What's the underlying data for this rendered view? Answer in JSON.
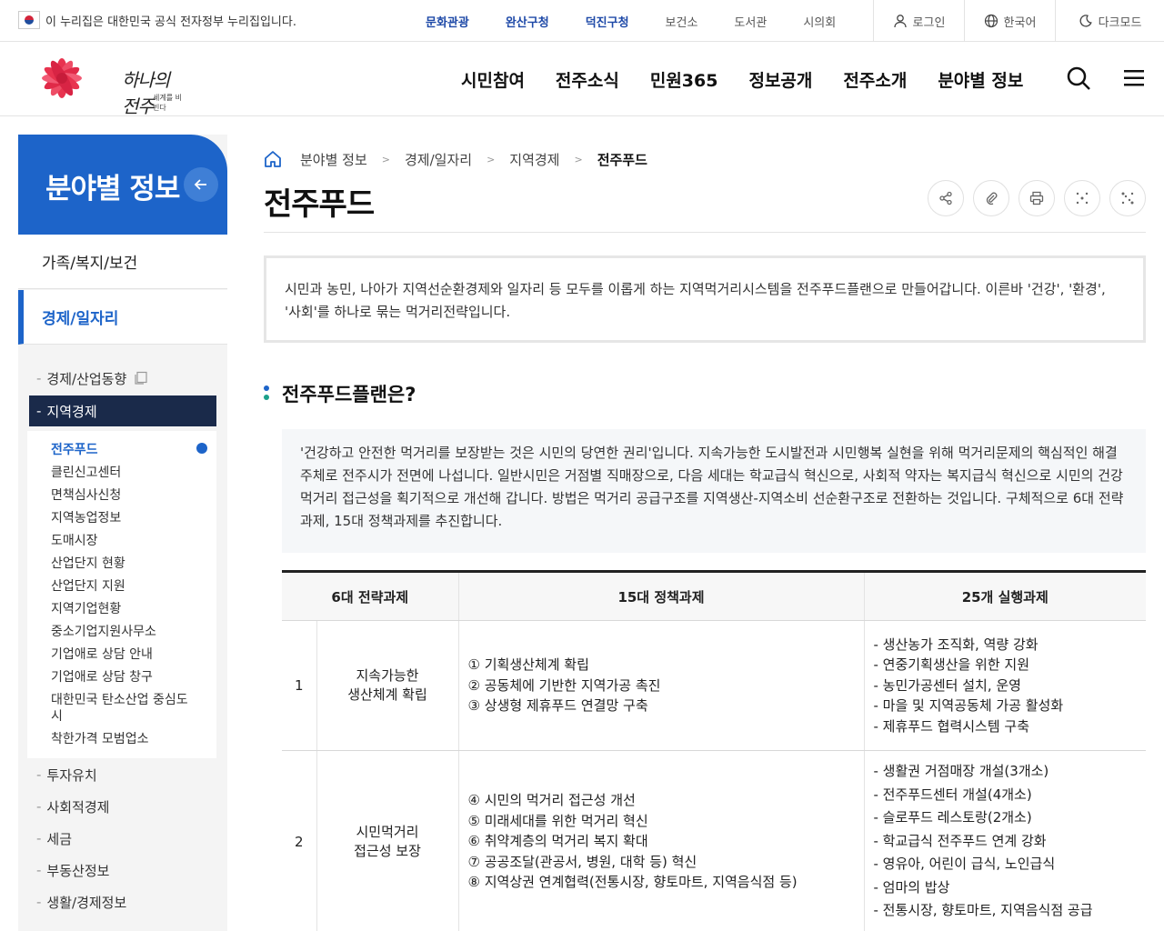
{
  "topbar": {
    "gov_notice": "이 누리집은 대한민국 공식 전자정부 누리집입니다.",
    "sites": [
      {
        "label": "문화관광",
        "highlight": true
      },
      {
        "label": "완산구청",
        "highlight": true
      },
      {
        "label": "덕진구청",
        "highlight": true
      },
      {
        "label": "보건소",
        "highlight": false
      },
      {
        "label": "도서관",
        "highlight": false
      },
      {
        "label": "시의회",
        "highlight": false
      }
    ],
    "login": "로그인",
    "language": "한국어",
    "dark_mode": "다크모드"
  },
  "header": {
    "logo_script": "하나의 전주",
    "logo_sub": "세계를 비빈다",
    "nav": [
      "시민참여",
      "전주소식",
      "민원365",
      "정보공개",
      "전주소개",
      "분야별 정보"
    ]
  },
  "sidebar": {
    "title": "분야별 정보",
    "categories": [
      "가족/복지/보건",
      "경제/일자리"
    ],
    "subs_top": [
      "경제/산업동향",
      "지역경제"
    ],
    "leaves": [
      "전주푸드",
      "클린신고센터",
      "면책심사신청",
      "지역농업정보",
      "도매시장",
      "산업단지 현황",
      "산업단지 지원",
      "지역기업현황",
      "중소기업지원사무소",
      "기업애로 상담 안내",
      "기업애로 상담 창구",
      "대한민국 탄소산업 중심도시",
      "착한가격 모범업소"
    ],
    "subs_bottom": [
      "투자유치",
      "사회적경제",
      "세금",
      "부동산정보",
      "생활/경제정보"
    ]
  },
  "content": {
    "breadcrumb": [
      "분야별 정보",
      "경제/일자리",
      "지역경제",
      "전주푸드"
    ],
    "title": "전주푸드",
    "intro": "시민과 농민, 나아가 지역선순환경제와 일자리 등 모두를 이롭게 하는 지역먹거리시스템을 전주푸드플랜으로 만들어갑니다. 이른바 '건강', '환경', '사회'를 하나로 묶는 먹거리전략입니다.",
    "section_title": "전주푸드플랜은?",
    "section_body": "'건강하고 안전한 먹거리를 보장받는 것은 시민의 당연한 권리'입니다. 지속가능한 도시발전과 시민행복 실현을 위해 먹거리문제의 핵심적인 해결주체로 전주시가 전면에 나섭니다. 일반시민은 거점별 직매장으로, 다음 세대는 학교급식 혁신으로, 사회적 약자는 복지급식 혁신으로 시민의 건강먹거리 접근성을 획기적으로 개선해 갑니다. 방법은 먹거리 공급구조를 지역생산-지역소비 선순환구조로 전환하는 것입니다. 구체적으로 6대 전략과제, 15대 정책과제를 추진합니다."
  },
  "table": {
    "headers": [
      "6대 전략과제",
      "15대 정책과제",
      "25개 실행과제"
    ],
    "rows": [
      {
        "num": "1",
        "strategy": [
          "지속가능한",
          "생산체계 확립"
        ],
        "policies": [
          "① 기획생산체계 확립",
          "② 공동체에 기반한 지역가공 촉진",
          "③ 상생형 제휴푸드 연결망 구축"
        ],
        "tasks": [
          "- 생산농가 조직화, 역량 강화",
          "- 연중기획생산을 위한 지원",
          "- 농민가공센터 설치, 운영",
          "- 마을 및 지역공동체 가공 활성화",
          "- 제휴푸드 협력시스템 구축"
        ]
      },
      {
        "num": "2",
        "strategy": [
          "시민먹거리",
          "접근성 보장"
        ],
        "policies": [
          "④ 시민의 먹거리 접근성 개선",
          "⑤ 미래세대를 위한 먹거리 혁신",
          "⑥ 취약계층의 먹거리 복지 확대",
          "⑦ 공공조달(관공서, 병원, 대학 등) 혁신",
          "⑧ 지역상권 연계협력(전통시장, 향토마트, 지역음식점 등)"
        ],
        "tasks": [
          "- 생활권 거점매장 개설(3개소)",
          "- 전주푸드센터 개설(4개소)",
          "- 슬로푸드 레스토랑(2개소)",
          "- 학교급식 전주푸드 연계 강화",
          "- 영유아, 어린이 급식, 노인급식",
          "- 엄마의 밥상",
          "- 전통시장, 향토마트, 지역음식점 공급"
        ]
      }
    ]
  }
}
